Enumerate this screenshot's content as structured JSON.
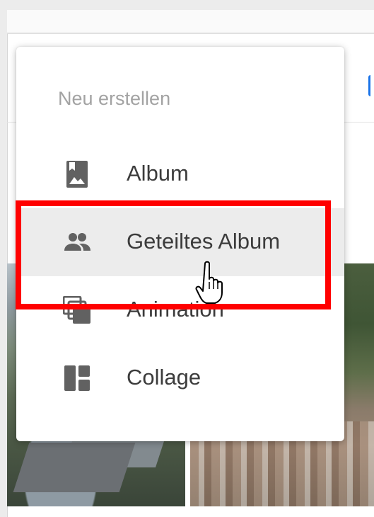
{
  "menu": {
    "header": "Neu erstellen",
    "items": [
      {
        "label": "Album",
        "icon": "photo-album-icon",
        "hovered": false
      },
      {
        "label": "Geteiltes Album",
        "icon": "people-icon",
        "hovered": true
      },
      {
        "label": "Animation",
        "icon": "animation-icon",
        "hovered": false
      },
      {
        "label": "Collage",
        "icon": "collage-icon",
        "hovered": false
      }
    ]
  },
  "colors": {
    "icon": "#616161",
    "label": "#3c3c3c",
    "header": "#a3a3a3",
    "hover_background": "#ececec",
    "highlight_border": "#ff0000"
  }
}
